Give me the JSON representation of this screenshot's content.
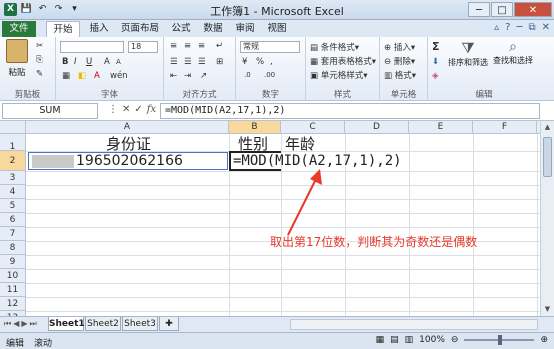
{
  "title_bar": {
    "title": "工作簿1 - Microsoft Excel",
    "qat_icons": [
      "excel-logo-icon",
      "save-icon",
      "undo-icon",
      "redo-icon",
      "customize-icon"
    ]
  },
  "ribbon_tabs": [
    "文件",
    "开始",
    "插入",
    "页面布局",
    "公式",
    "数据",
    "审阅",
    "视图"
  ],
  "ribbon": {
    "clipboard": {
      "label": "剪贴板",
      "paste": "粘贴"
    },
    "font": {
      "label": "字体",
      "font_name": "",
      "font_size": "18",
      "bold": "B",
      "italic": "I",
      "underline": "U",
      "grow": "A",
      "shrink": "A",
      "wen": "wén"
    },
    "alignment": {
      "label": "对齐方式"
    },
    "number": {
      "label": "数字",
      "format": "常规",
      "percent": "%",
      "comma": ",",
      "inc": ".0",
      "dec": ".00"
    },
    "styles": {
      "label": "样式",
      "items": [
        "条件格式",
        "套用表格格式",
        "单元格样式"
      ]
    },
    "cells": {
      "label": "单元格",
      "items": [
        "插入",
        "删除",
        "格式"
      ]
    },
    "editing": {
      "label": "编辑",
      "sum": "Σ",
      "sort_filter": "排序和筛选",
      "find_select": "查找和选择"
    }
  },
  "formula_bar": {
    "name_box": "SUM",
    "fx": "fx",
    "formula": "=MOD(MID(A2,17,1),2)"
  },
  "sheet": {
    "columns": [
      "A",
      "B",
      "C",
      "D",
      "E",
      "F",
      "G"
    ],
    "rows": [
      "1",
      "2",
      "3",
      "4",
      "5",
      "6",
      "7",
      "8",
      "9",
      "10",
      "11",
      "12",
      "13"
    ],
    "a1": "身份证",
    "b1": "性别",
    "c1": "年龄",
    "a2_masked": "3      ",
    "a2": "196502062166",
    "b2_formula": "=MOD(MID(A2,17,1),2)"
  },
  "annotation": {
    "text": "取出第17位数，判断其为奇数还是偶数",
    "color": "#e8392a"
  },
  "sheet_tabs": [
    "Sheet1",
    "Sheet2",
    "Sheet3"
  ],
  "status_bar": {
    "left": [
      "编辑",
      "滚动"
    ],
    "zoom": "100%"
  }
}
